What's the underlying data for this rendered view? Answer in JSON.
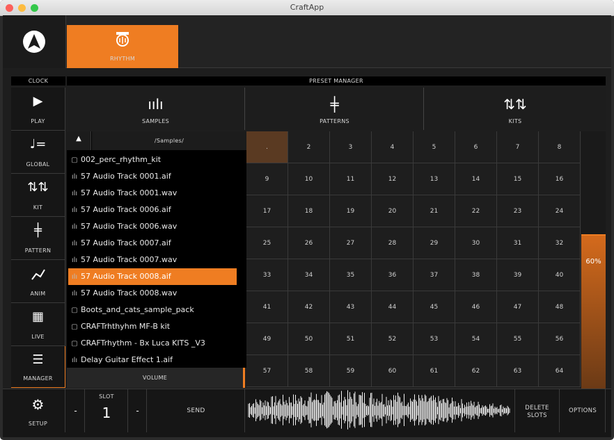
{
  "window": {
    "title": "CraftApp"
  },
  "header": {
    "rhythm_label": "RHYTHM"
  },
  "bars": {
    "clock": "CLOCK",
    "preset_manager": "PRESET MANAGER"
  },
  "sidebar": {
    "items": [
      {
        "label": "PLAY",
        "icon": "play-icon"
      },
      {
        "label": "GLOBAL",
        "icon": "note-icon"
      },
      {
        "label": "KIT",
        "icon": "sliders-icon"
      },
      {
        "label": "PATTERN",
        "icon": "pattern-icon"
      },
      {
        "label": "ANIM",
        "icon": "anim-icon"
      },
      {
        "label": "LIVE",
        "icon": "grid-icon"
      },
      {
        "label": "MANAGER",
        "icon": "menu-icon"
      },
      {
        "label": "SETUP",
        "icon": "gears-icon"
      }
    ]
  },
  "tabs": [
    {
      "label": "SAMPLES",
      "icon": "waveform-icon"
    },
    {
      "label": "PATTERNS",
      "icon": "pattern-icon"
    },
    {
      "label": "KITS",
      "icon": "sliders-icon"
    }
  ],
  "browser": {
    "path": "/Samples/",
    "files": [
      {
        "name": "002_perc_rhythm_kit",
        "type": "folder"
      },
      {
        "name": "57 Audio Track 0001.aif",
        "type": "audio"
      },
      {
        "name": "57 Audio Track 0001.wav",
        "type": "audio"
      },
      {
        "name": "57 Audio Track 0006.aif",
        "type": "audio"
      },
      {
        "name": "57 Audio Track 0006.wav",
        "type": "audio"
      },
      {
        "name": "57 Audio Track 0007.aif",
        "type": "audio"
      },
      {
        "name": "57 Audio Track 0007.wav",
        "type": "audio"
      },
      {
        "name": "57 Audio Track 0008.aif",
        "type": "audio",
        "selected": true
      },
      {
        "name": "57 Audio Track 0008.wav",
        "type": "audio"
      },
      {
        "name": "Boots_and_cats_sample_pack",
        "type": "folder"
      },
      {
        "name": "CRAFTrhthyhm MF-B kit",
        "type": "folder"
      },
      {
        "name": "CRAFTrhythm - Bx Luca KITS _V3",
        "type": "folder"
      },
      {
        "name": "Delay Guitar Effect 1.aif",
        "type": "audio"
      }
    ],
    "volume_label": "VOLUME"
  },
  "pads": {
    "rows": [
      [
        ".",
        "2",
        "3",
        "4",
        "5",
        "6",
        "7",
        "8"
      ],
      [
        "9",
        "10",
        "11",
        "12",
        "13",
        "14",
        "15",
        "16"
      ],
      [
        "17",
        "18",
        "19",
        "20",
        "21",
        "22",
        "23",
        "24"
      ],
      [
        "25",
        "26",
        "27",
        "28",
        "29",
        "30",
        "31",
        "32"
      ],
      [
        "33",
        "34",
        "35",
        "36",
        "37",
        "38",
        "39",
        "40"
      ],
      [
        "41",
        "42",
        "43",
        "44",
        "45",
        "46",
        "47",
        "48"
      ],
      [
        "49",
        "50",
        "51",
        "52",
        "53",
        "54",
        "55",
        "56"
      ],
      [
        "57",
        "58",
        "59",
        "60",
        "61",
        "62",
        "63",
        "64"
      ]
    ]
  },
  "level": {
    "label": "60%",
    "value": 0.6
  },
  "bottom": {
    "minus": "-",
    "slot_label": "SLOT",
    "slot_value": "1",
    "plus": "-",
    "send": "SEND",
    "delete_slots": "DELETE SLOTS",
    "options": "OPTIONS"
  },
  "colors": {
    "accent": "#ef7d22",
    "background": "#1e1e1e"
  }
}
